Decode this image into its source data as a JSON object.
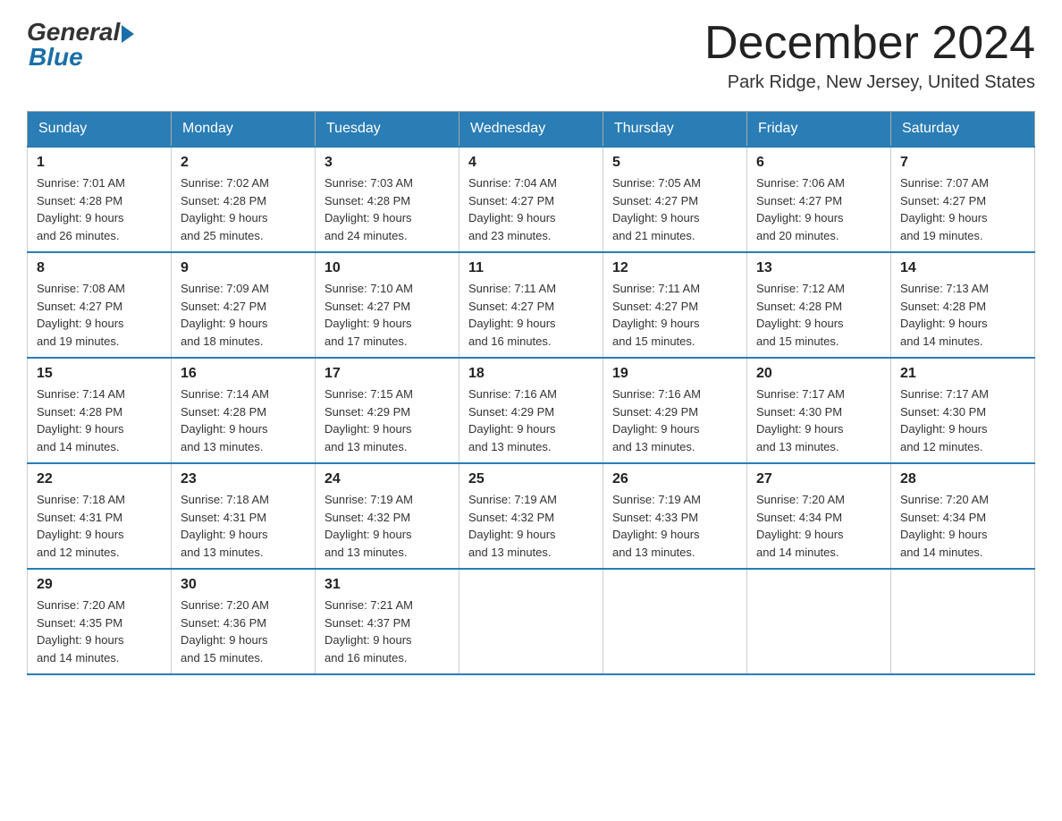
{
  "header": {
    "logo_general": "General",
    "logo_blue": "Blue",
    "title": "December 2024",
    "location": "Park Ridge, New Jersey, United States"
  },
  "days_of_week": [
    "Sunday",
    "Monday",
    "Tuesday",
    "Wednesday",
    "Thursday",
    "Friday",
    "Saturday"
  ],
  "weeks": [
    [
      {
        "day": "1",
        "sunrise": "7:01 AM",
        "sunset": "4:28 PM",
        "daylight": "9 hours and 26 minutes."
      },
      {
        "day": "2",
        "sunrise": "7:02 AM",
        "sunset": "4:28 PM",
        "daylight": "9 hours and 25 minutes."
      },
      {
        "day": "3",
        "sunrise": "7:03 AM",
        "sunset": "4:28 PM",
        "daylight": "9 hours and 24 minutes."
      },
      {
        "day": "4",
        "sunrise": "7:04 AM",
        "sunset": "4:27 PM",
        "daylight": "9 hours and 23 minutes."
      },
      {
        "day": "5",
        "sunrise": "7:05 AM",
        "sunset": "4:27 PM",
        "daylight": "9 hours and 21 minutes."
      },
      {
        "day": "6",
        "sunrise": "7:06 AM",
        "sunset": "4:27 PM",
        "daylight": "9 hours and 20 minutes."
      },
      {
        "day": "7",
        "sunrise": "7:07 AM",
        "sunset": "4:27 PM",
        "daylight": "9 hours and 19 minutes."
      }
    ],
    [
      {
        "day": "8",
        "sunrise": "7:08 AM",
        "sunset": "4:27 PM",
        "daylight": "9 hours and 19 minutes."
      },
      {
        "day": "9",
        "sunrise": "7:09 AM",
        "sunset": "4:27 PM",
        "daylight": "9 hours and 18 minutes."
      },
      {
        "day": "10",
        "sunrise": "7:10 AM",
        "sunset": "4:27 PM",
        "daylight": "9 hours and 17 minutes."
      },
      {
        "day": "11",
        "sunrise": "7:11 AM",
        "sunset": "4:27 PM",
        "daylight": "9 hours and 16 minutes."
      },
      {
        "day": "12",
        "sunrise": "7:11 AM",
        "sunset": "4:27 PM",
        "daylight": "9 hours and 15 minutes."
      },
      {
        "day": "13",
        "sunrise": "7:12 AM",
        "sunset": "4:28 PM",
        "daylight": "9 hours and 15 minutes."
      },
      {
        "day": "14",
        "sunrise": "7:13 AM",
        "sunset": "4:28 PM",
        "daylight": "9 hours and 14 minutes."
      }
    ],
    [
      {
        "day": "15",
        "sunrise": "7:14 AM",
        "sunset": "4:28 PM",
        "daylight": "9 hours and 14 minutes."
      },
      {
        "day": "16",
        "sunrise": "7:14 AM",
        "sunset": "4:28 PM",
        "daylight": "9 hours and 13 minutes."
      },
      {
        "day": "17",
        "sunrise": "7:15 AM",
        "sunset": "4:29 PM",
        "daylight": "9 hours and 13 minutes."
      },
      {
        "day": "18",
        "sunrise": "7:16 AM",
        "sunset": "4:29 PM",
        "daylight": "9 hours and 13 minutes."
      },
      {
        "day": "19",
        "sunrise": "7:16 AM",
        "sunset": "4:29 PM",
        "daylight": "9 hours and 13 minutes."
      },
      {
        "day": "20",
        "sunrise": "7:17 AM",
        "sunset": "4:30 PM",
        "daylight": "9 hours and 13 minutes."
      },
      {
        "day": "21",
        "sunrise": "7:17 AM",
        "sunset": "4:30 PM",
        "daylight": "9 hours and 12 minutes."
      }
    ],
    [
      {
        "day": "22",
        "sunrise": "7:18 AM",
        "sunset": "4:31 PM",
        "daylight": "9 hours and 12 minutes."
      },
      {
        "day": "23",
        "sunrise": "7:18 AM",
        "sunset": "4:31 PM",
        "daylight": "9 hours and 13 minutes."
      },
      {
        "day": "24",
        "sunrise": "7:19 AM",
        "sunset": "4:32 PM",
        "daylight": "9 hours and 13 minutes."
      },
      {
        "day": "25",
        "sunrise": "7:19 AM",
        "sunset": "4:32 PM",
        "daylight": "9 hours and 13 minutes."
      },
      {
        "day": "26",
        "sunrise": "7:19 AM",
        "sunset": "4:33 PM",
        "daylight": "9 hours and 13 minutes."
      },
      {
        "day": "27",
        "sunrise": "7:20 AM",
        "sunset": "4:34 PM",
        "daylight": "9 hours and 14 minutes."
      },
      {
        "day": "28",
        "sunrise": "7:20 AM",
        "sunset": "4:34 PM",
        "daylight": "9 hours and 14 minutes."
      }
    ],
    [
      {
        "day": "29",
        "sunrise": "7:20 AM",
        "sunset": "4:35 PM",
        "daylight": "9 hours and 14 minutes."
      },
      {
        "day": "30",
        "sunrise": "7:20 AM",
        "sunset": "4:36 PM",
        "daylight": "9 hours and 15 minutes."
      },
      {
        "day": "31",
        "sunrise": "7:21 AM",
        "sunset": "4:37 PM",
        "daylight": "9 hours and 16 minutes."
      },
      null,
      null,
      null,
      null
    ]
  ],
  "labels": {
    "sunrise": "Sunrise:",
    "sunset": "Sunset:",
    "daylight": "Daylight: 9 hours"
  }
}
